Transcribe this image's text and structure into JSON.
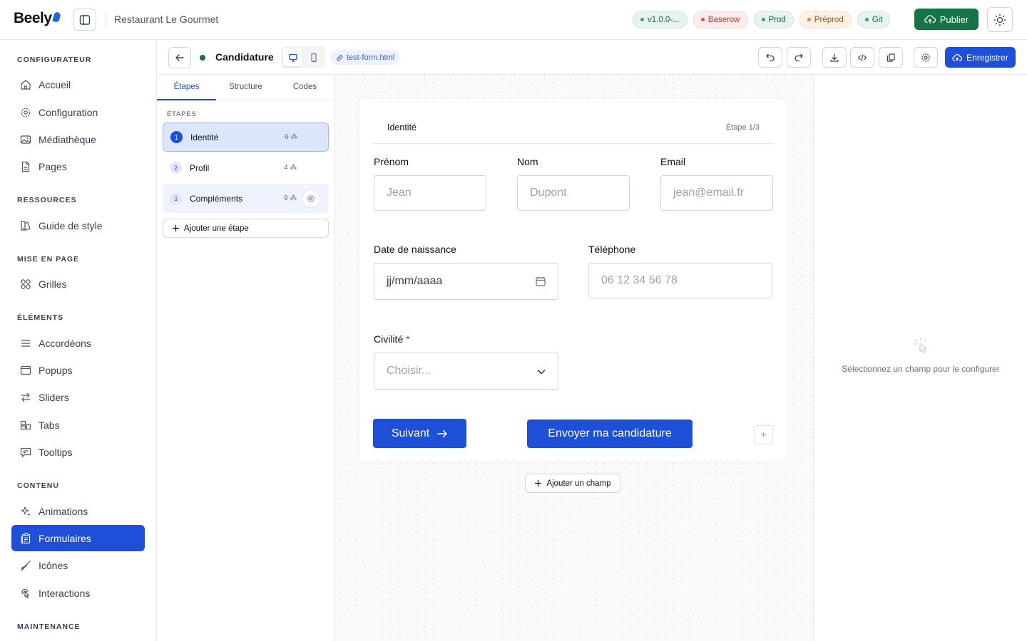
{
  "topbar": {
    "logo": "Beely",
    "project": "Restaurant Le Gourmet",
    "badges": [
      {
        "label": "v1.0.0-...",
        "tone": "green"
      },
      {
        "label": "Baserow",
        "tone": "red"
      },
      {
        "label": "Prod",
        "tone": "green"
      },
      {
        "label": "Préprod",
        "tone": "orange"
      },
      {
        "label": "Git",
        "tone": "green"
      }
    ],
    "publish_label": "Publier",
    "colors": {
      "publish": "#157347",
      "accent": "#1d4fd8"
    }
  },
  "sidebar": {
    "sections": [
      {
        "title": "CONFIGURATEUR",
        "items": [
          {
            "label": "Accueil",
            "icon": "home-icon"
          },
          {
            "label": "Configuration",
            "icon": "gear-icon"
          },
          {
            "label": "Médiathèque",
            "icon": "image-icon"
          },
          {
            "label": "Pages",
            "icon": "file-icon"
          }
        ]
      },
      {
        "title": "RESSOURCES",
        "items": [
          {
            "label": "Guide de style",
            "icon": "palette-icon"
          }
        ]
      },
      {
        "title": "MISE EN PAGE",
        "items": [
          {
            "label": "Grilles",
            "icon": "grid-icon"
          }
        ]
      },
      {
        "title": "ÉLÉMENTS",
        "items": [
          {
            "label": "Accordéons",
            "icon": "list-icon"
          },
          {
            "label": "Popups",
            "icon": "window-icon"
          },
          {
            "label": "Sliders",
            "icon": "arrows-icon"
          },
          {
            "label": "Tabs",
            "icon": "tabs-icon"
          },
          {
            "label": "Tooltips",
            "icon": "message-icon"
          }
        ]
      },
      {
        "title": "CONTENU",
        "items": [
          {
            "label": "Animations",
            "icon": "sparkles-icon"
          },
          {
            "label": "Formulaires",
            "icon": "form-icon",
            "active": true
          },
          {
            "label": "Icônes",
            "icon": "brush-icon"
          },
          {
            "label": "Interactions",
            "icon": "pointer-icon"
          }
        ]
      },
      {
        "title": "MAINTENANCE",
        "items": []
      }
    ]
  },
  "editor": {
    "title": "Candidature",
    "file": "test-form.html",
    "save_label": "Enregistrer"
  },
  "steps_panel": {
    "tabs": [
      "Étapes",
      "Structure",
      "Codes"
    ],
    "active_tab": "Étapes",
    "section_label": "ÉTAPES",
    "steps": [
      {
        "num": "1",
        "label": "Identité",
        "count": "6"
      },
      {
        "num": "2",
        "label": "Profil",
        "count": "4"
      },
      {
        "num": "3",
        "label": "Compléments",
        "count": "9"
      }
    ],
    "add_step_label": "Ajouter une étape"
  },
  "form": {
    "step_name": "Identité",
    "step_progress": "Étape 1/3",
    "fields": {
      "prenom": {
        "label": "Prénom",
        "placeholder": "Jean"
      },
      "nom": {
        "label": "Nom",
        "placeholder": "Dupont"
      },
      "email": {
        "label": "Email",
        "placeholder": "jean@email.fr"
      },
      "naissance": {
        "label": "Date de naissance",
        "value": "jj/mm/aaaa"
      },
      "telephone": {
        "label": "Téléphone",
        "placeholder": "06 12 34 56 78"
      },
      "civilite": {
        "label": "Civilité",
        "required_mark": "*",
        "placeholder": "Choisir..."
      }
    },
    "next_label": "Suivant",
    "submit_label": "Envoyer ma candidature",
    "add_field_label": "Ajouter un champ"
  },
  "props_panel": {
    "empty_text": "Sélectionnez un champ pour le configurer"
  }
}
